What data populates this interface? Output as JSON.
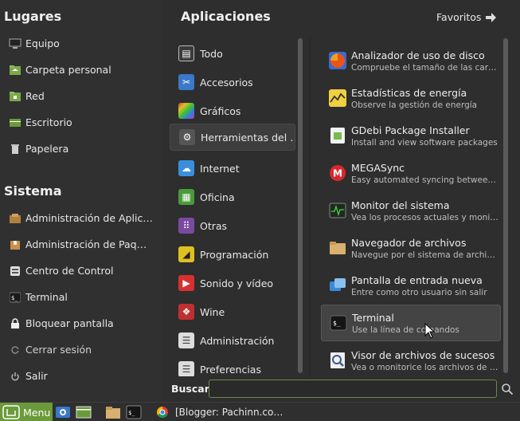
{
  "places": {
    "title": "Lugares",
    "items": [
      {
        "label": "Equipo",
        "icon": "computer-icon"
      },
      {
        "label": "Carpeta personal",
        "icon": "home-folder-icon"
      },
      {
        "label": "Red",
        "icon": "network-folder-icon"
      },
      {
        "label": "Escritorio",
        "icon": "desktop-icon"
      },
      {
        "label": "Papelera",
        "icon": "trash-icon"
      }
    ]
  },
  "system": {
    "title": "Sistema",
    "items": [
      {
        "label": "Administración de Aplicac…",
        "icon": "software-manager-icon"
      },
      {
        "label": "Administración de Paquet…",
        "icon": "package-manager-icon"
      },
      {
        "label": "Centro de Control",
        "icon": "control-center-icon"
      },
      {
        "label": "Terminal",
        "icon": "terminal-icon"
      },
      {
        "label": "Bloquear pantalla",
        "icon": "lock-icon"
      },
      {
        "label": "Cerrar sesión",
        "icon": "logout-icon"
      },
      {
        "label": "Salir",
        "icon": "power-icon"
      }
    ]
  },
  "applications": {
    "title": "Aplicaciones",
    "favorites_label": "Favoritos",
    "categories": [
      {
        "label": "Todo",
        "color": "#3a3a3a",
        "glyph": "▤"
      },
      {
        "label": "Accesorios",
        "color": "#3a78c9",
        "glyph": "✂"
      },
      {
        "label": "Gráficos",
        "color": "#c03ab0",
        "glyph": ""
      },
      {
        "label": "Herramientas del …",
        "color": "#555555",
        "glyph": "⚙"
      },
      {
        "label": "Internet",
        "color": "#3a8fdc",
        "glyph": "☁"
      },
      {
        "label": "Oficina",
        "color": "#4a9a3a",
        "glyph": "▦"
      },
      {
        "label": "Otras",
        "color": "#7a4aa0",
        "glyph": "⋮⋮"
      },
      {
        "label": "Programación",
        "color": "#e0c020",
        "glyph": "◢"
      },
      {
        "label": "Sonido y vídeo",
        "color": "#d83030",
        "glyph": "▶"
      },
      {
        "label": "Wine",
        "color": "#c03030",
        "glyph": "❖"
      },
      {
        "label": "Administración",
        "color": "#dddddd",
        "glyph": "☰"
      },
      {
        "label": "Preferencias",
        "color": "#dddddd",
        "glyph": "☰"
      }
    ],
    "selected_category": "Herramientas del …",
    "apps": [
      {
        "name": "Analizador de uso de disco",
        "desc": "Compruebe el tamaño de las carpet…",
        "icon": "disk-usage-icon"
      },
      {
        "name": "Estadísticas de energía",
        "desc": "Observe la gestión de energía",
        "icon": "power-statistics-icon"
      },
      {
        "name": "GDebi Package Installer",
        "desc": "Install and view software packages",
        "icon": "package-installer-icon"
      },
      {
        "name": "MEGASync",
        "desc": "Easy automated syncing between y…",
        "icon": "mega-icon"
      },
      {
        "name": "Monitor del sistema",
        "desc": "Vea los procesos actuales y monitor…",
        "icon": "system-monitor-icon"
      },
      {
        "name": "Navegador de archivos",
        "desc": "Navegue por el sistema de archivos…",
        "icon": "file-manager-icon"
      },
      {
        "name": "Pantalla de entrada nueva",
        "desc": "Entre como otro usuario sin salir",
        "icon": "new-login-icon"
      },
      {
        "name": "Terminal",
        "desc": "Use la línea de comandos",
        "icon": "terminal-icon"
      },
      {
        "name": "Visor de archivos de sucesos",
        "desc": "Vea o monitorice los archivos de su…",
        "icon": "log-viewer-icon"
      }
    ],
    "highlighted_app": "Terminal"
  },
  "search": {
    "label": "Buscar:",
    "value": ""
  },
  "taskbar": {
    "menu_label": "Menu",
    "window_title": "[Blogger: Pachinn.co…"
  }
}
